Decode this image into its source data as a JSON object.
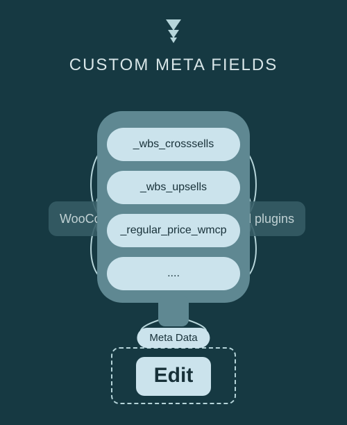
{
  "heading": "CUSTOM META FIELDS",
  "fields": {
    "f1": "_wbs_crosssells",
    "f2": "_wbs_upsells",
    "f3": "_regular_price_wmcp",
    "f4": "...."
  },
  "side": {
    "left": "WooCom",
    "right": "3rd plugins"
  },
  "meta_label": "Meta Data",
  "edit_label": "Edit",
  "colors": {
    "bg": "#163942",
    "funnel": "#5f8892",
    "pill": "#cbe3ec",
    "accent_text": "#d8e6e8"
  }
}
